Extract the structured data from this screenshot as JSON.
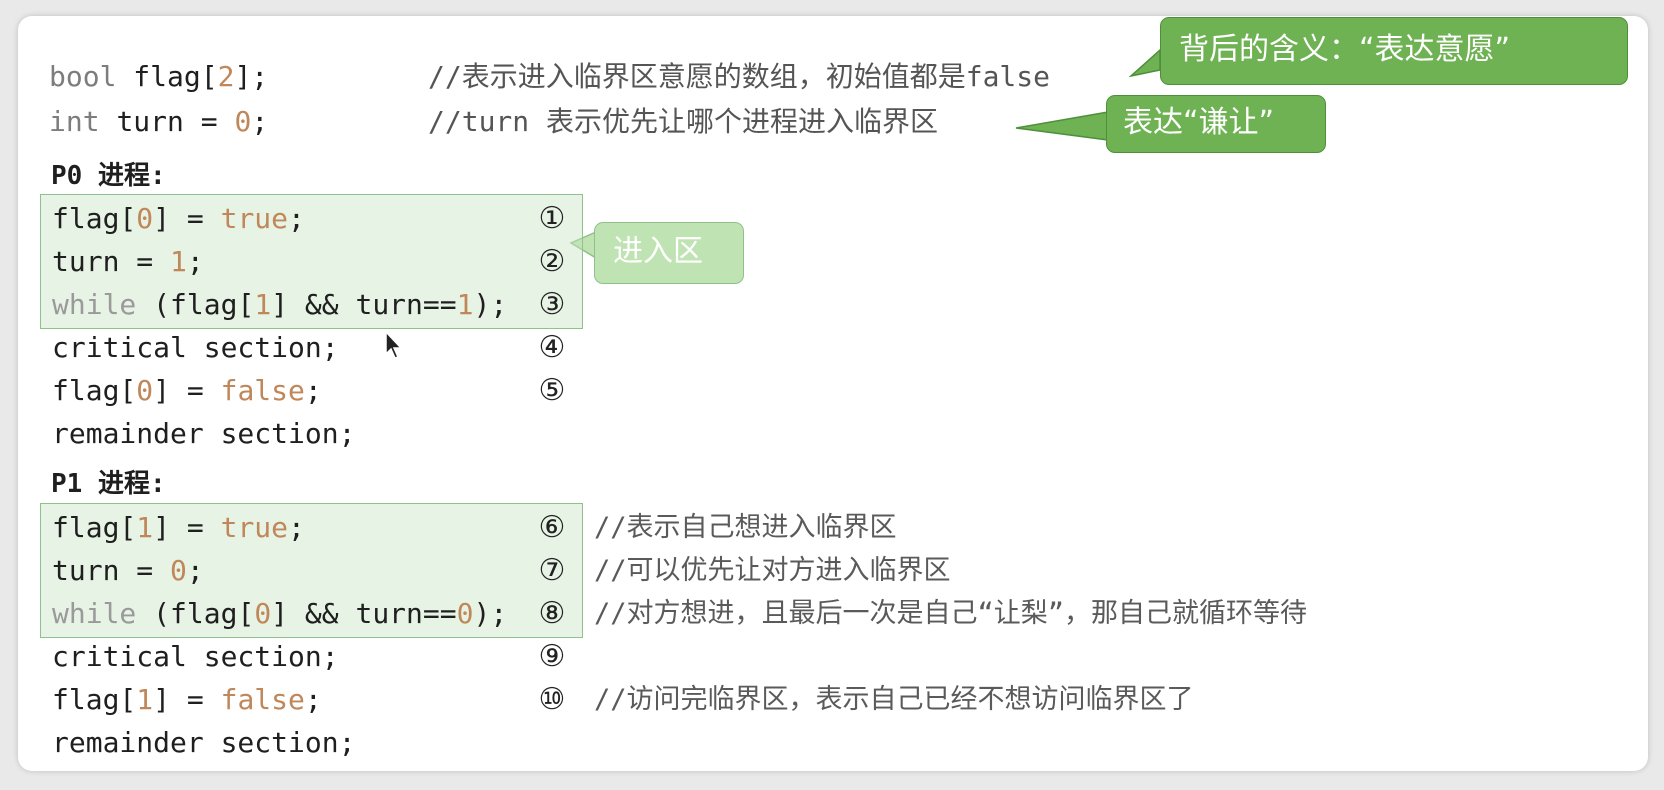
{
  "header": {
    "flag_decl": {
      "type": "bool",
      "name": "flag[",
      "size": "2",
      "end": "];",
      "comment": "//表示进入临界区意愿的数组，初始值都是false"
    },
    "turn_decl": {
      "type": "int",
      "name": "turn = ",
      "value": "0",
      "end": ";",
      "comment": "//turn 表示优先让哪个进程进入临界区"
    }
  },
  "callouts": {
    "willingness": "背后的含义：“表达意愿”",
    "humility": "表达“谦让”",
    "entry_section": "进入区"
  },
  "p0": {
    "title": "P0 进程:",
    "lines": [
      {
        "pre": "flag[",
        "n": "0",
        "mid": "] = ",
        "v": "true",
        "end": ";",
        "num": "①"
      },
      {
        "pre": "turn = ",
        "n": "1",
        "end": ";",
        "num": "②"
      },
      {
        "kw": "while",
        "pre": " (flag[",
        "n": "1",
        "mid": "] && turn==",
        "n2": "1",
        "end": ");",
        "num": "③"
      },
      {
        "text": "critical section;",
        "num": "④"
      },
      {
        "pre": "flag[",
        "n": "0",
        "mid": "] = ",
        "v": "false",
        "end": ";",
        "num": "⑤"
      },
      {
        "text": "remainder section;"
      }
    ]
  },
  "p1": {
    "title": "P1 进程:",
    "lines": [
      {
        "pre": "flag[",
        "n": "1",
        "mid": "] = ",
        "v": "true",
        "end": ";",
        "num": "⑥",
        "comment": "//表示自己想进入临界区"
      },
      {
        "pre": "turn = ",
        "n": "0",
        "end": ";",
        "num": "⑦",
        "comment": "//可以优先让对方进入临界区"
      },
      {
        "kw": "while",
        "pre": " (flag[",
        "n": "0",
        "mid": "] && turn==",
        "n2": "0",
        "end": ");",
        "num": "⑧",
        "comment": "//对方想进，且最后一次是自己“让梨”，那自己就循环等待"
      },
      {
        "text": "critical section;",
        "num": "⑨"
      },
      {
        "pre": "flag[",
        "n": "1",
        "mid": "] = ",
        "v": "false",
        "end": ";",
        "num": "⑩",
        "comment": "//访问完临界区，表示自己已经不想访问临界区了"
      },
      {
        "text": "remainder section;"
      }
    ]
  },
  "colors": {
    "callout_green": "#6fb253",
    "callout_light_green": "#bfe3b3",
    "highlight_box": "#c6e2be",
    "number_literal": "#c0885a"
  }
}
